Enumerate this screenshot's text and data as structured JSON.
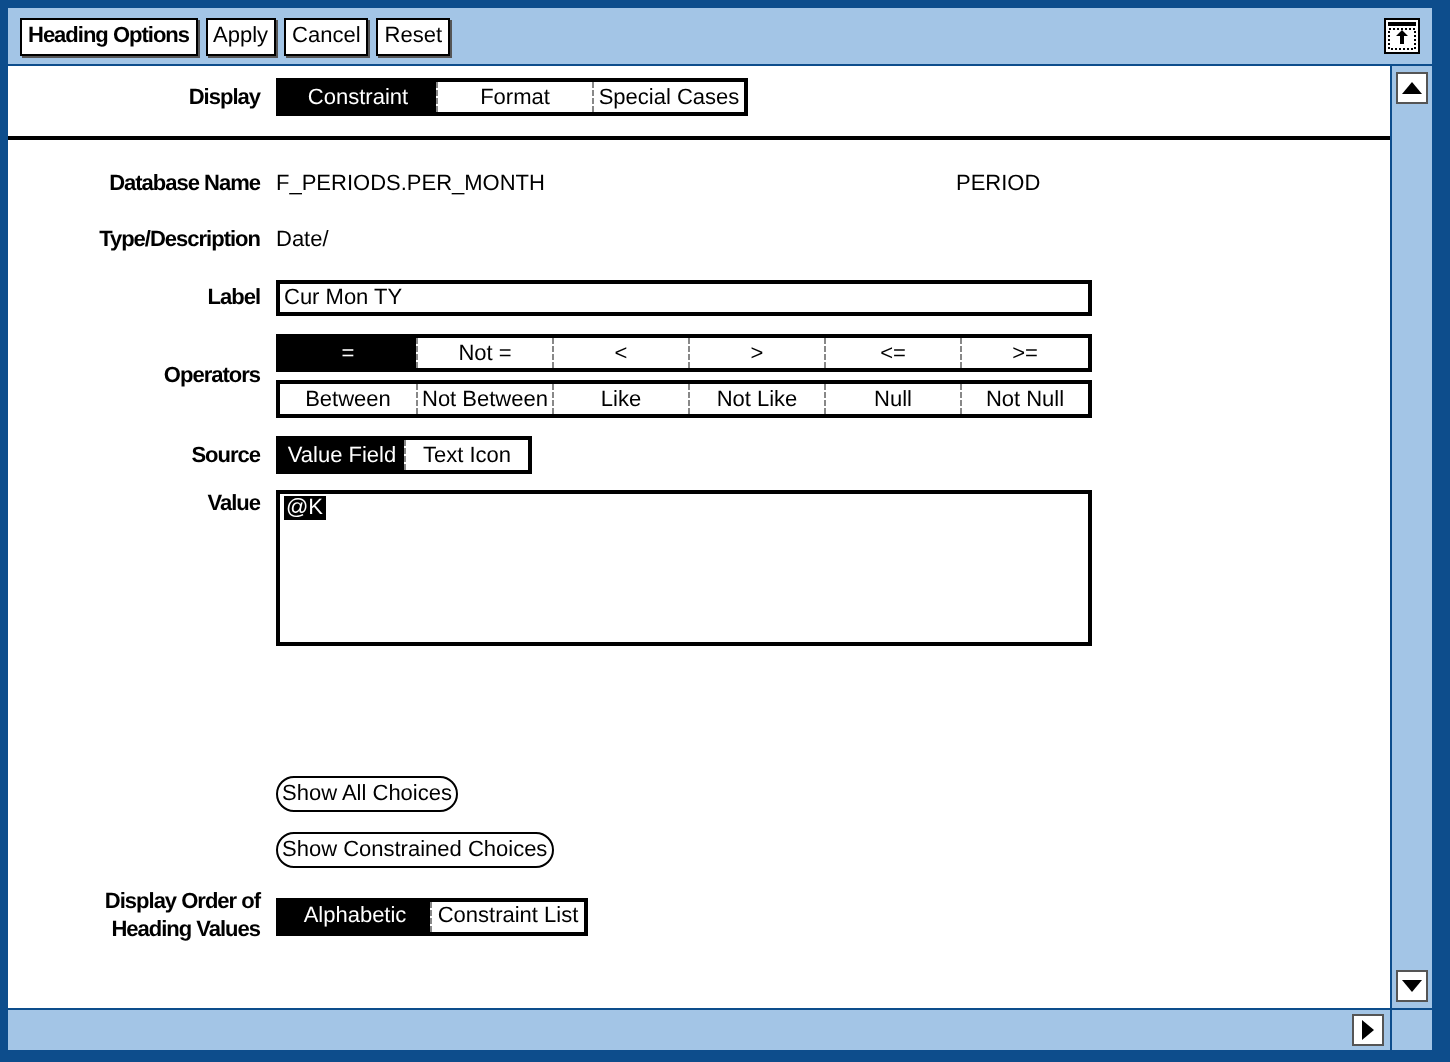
{
  "toolbar": {
    "buttons": [
      {
        "label": "Heading Options",
        "kind": "primary"
      },
      {
        "label": "Apply",
        "kind": "normal"
      },
      {
        "label": "Cancel",
        "kind": "normal"
      },
      {
        "label": "Reset",
        "kind": "normal"
      }
    ]
  },
  "display": {
    "label": "Display",
    "options": [
      {
        "label": "Constraint",
        "selected": true
      },
      {
        "label": "Format",
        "selected": false
      },
      {
        "label": "Special Cases",
        "selected": false
      }
    ]
  },
  "database_name": {
    "label": "Database Name",
    "value": "F_PERIODS.PER_MONTH",
    "extra": "PERIOD"
  },
  "type_description": {
    "label": "Type/Description",
    "value": "Date/"
  },
  "label_field": {
    "label": "Label",
    "value": "Cur Mon TY"
  },
  "operators": {
    "label": "Operators",
    "rows": [
      [
        {
          "label": "=",
          "selected": true
        },
        {
          "label": "Not =",
          "selected": false
        },
        {
          "label": "<",
          "selected": false
        },
        {
          "label": ">",
          "selected": false
        },
        {
          "label": "<=",
          "selected": false
        },
        {
          "label": ">=",
          "selected": false
        }
      ],
      [
        {
          "label": "Between",
          "selected": false
        },
        {
          "label": "Not Between",
          "selected": false
        },
        {
          "label": "Like",
          "selected": false
        },
        {
          "label": "Not Like",
          "selected": false
        },
        {
          "label": "Null",
          "selected": false
        },
        {
          "label": "Not Null",
          "selected": false
        }
      ]
    ]
  },
  "source": {
    "label": "Source",
    "options": [
      {
        "label": "Value Field",
        "selected": true
      },
      {
        "label": "Text Icon",
        "selected": false
      }
    ]
  },
  "value": {
    "label": "Value",
    "value": "@K",
    "text_selected": true
  },
  "choice_buttons": [
    "Show All Choices",
    "Show Constrained Choices"
  ],
  "display_order": {
    "label": "Display Order of Heading Values",
    "options": [
      {
        "label": "Alphabetic",
        "selected": true
      },
      {
        "label": "Constraint List",
        "selected": false
      }
    ]
  }
}
